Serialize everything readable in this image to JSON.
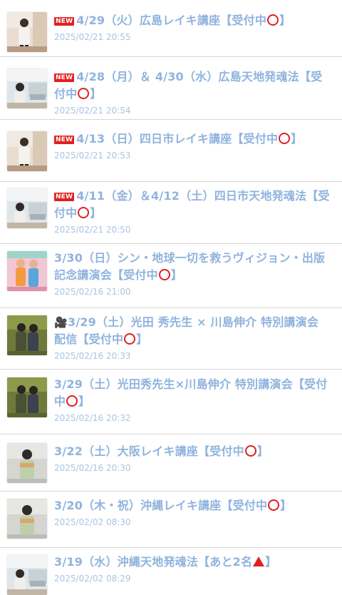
{
  "items": [
    {
      "new": true,
      "title_main": "4/29（火）広島レイキ講座【受付中",
      "title_end": "】",
      "mark": "circle",
      "date": "2025/02/21 20:55",
      "thumb": "reiki-pink"
    },
    {
      "new": true,
      "title_main": "4/28（月）＆ 4/30（水）広島天地発魂法【受付中",
      "title_end": "】",
      "mark": "circle",
      "date": "2025/02/21 20:54",
      "thumb": "room"
    },
    {
      "new": true,
      "title_main": "4/13（日）四日市レイキ講座【受付中",
      "title_end": "】",
      "mark": "circle",
      "date": "2025/02/21 20:53",
      "thumb": "reiki-pink"
    },
    {
      "new": true,
      "title_main": "4/11（金）＆4/12（土）四日市天地発魂法【受付中",
      "title_end": "】",
      "mark": "circle",
      "date": "2025/02/21 20:50",
      "thumb": "room"
    },
    {
      "new": false,
      "title_main": "3/30（日）シン・地球一切を救うヴィジョン・出版記念講演会【受付中",
      "title_end": "】",
      "mark": "circle",
      "date": "2025/02/16 21:00",
      "thumb": "duo-pink"
    },
    {
      "new": false,
      "camera": "🎥",
      "title_main": "3/29（土）光田 秀先生 × 川島伸介 特別講演会　配信【受付中",
      "title_end": "】",
      "mark": "circle",
      "date": "2025/02/16 20:33",
      "thumb": "duo-green"
    },
    {
      "new": false,
      "title_main": "3/29（土）光田秀先生×川島伸介 特別講演会【受付中",
      "title_end": "】",
      "mark": "circle",
      "date": "2025/02/16 20:32",
      "thumb": "duo-green"
    },
    {
      "new": false,
      "title_main": "3/22（土）大阪レイキ講座【受付中",
      "title_end": "】",
      "mark": "circle",
      "date": "2025/02/16 20:30",
      "thumb": "person-gray"
    },
    {
      "new": false,
      "title_main": "3/20（木・祝）沖縄レイキ講座【受付中",
      "title_end": "】",
      "mark": "circle",
      "date": "2025/02/02 08:30",
      "thumb": "person-gray"
    },
    {
      "new": false,
      "title_main": "3/19（水）沖縄天地発魂法【あと2名",
      "title_end": "】",
      "mark": "triangle",
      "date": "2025/02/02 08:29",
      "thumb": "room"
    }
  ],
  "new_badge_label": "NEW",
  "colors": {
    "title": "#8fb3de",
    "date": "#aac4e2",
    "accent": "#e02020",
    "divider": "#d6d6d6"
  }
}
